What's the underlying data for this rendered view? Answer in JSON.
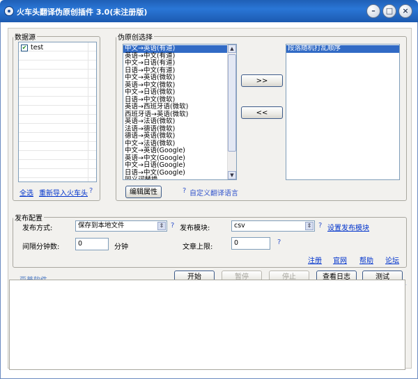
{
  "window": {
    "title": "火车头翻译伪原创插件 3.0(未注册版)",
    "min": "–",
    "max": "□",
    "close": "×"
  },
  "datasource": {
    "legend": "数据源",
    "items": [
      {
        "label": "test",
        "checked": true
      }
    ]
  },
  "pseudo": {
    "legend": "伪原创选择",
    "options": [
      "中文→英语(有道)",
      "英语→中文(有道)",
      "中文→日语(有道)",
      "日语→中文(有道)",
      "中文→英语(微软)",
      "英语→中文(微软)",
      "中文→日语(微软)",
      "日语→中文(微软)",
      "英语→西班牙语(微软)",
      "西班牙语→英语(微软)",
      "英语→法语(微软)",
      "法语→德语(微软)",
      "德语→英语(微软)",
      "中文→法语(微软)",
      "中文→英语(Google)",
      "英语→中文(Google)",
      "中文→日语(Google)",
      "日语→中文(Google)",
      "同义词替换"
    ],
    "selected": [
      "段落随机打乱顺序"
    ],
    "add_button": ">>",
    "remove_button": "<<",
    "edit_button": "编辑属性",
    "custom_help": "?",
    "custom_link": "自定义翻译语言"
  },
  "source_actions": {
    "select_all": "全选",
    "reimport": "重新导入火车头",
    "help": "?"
  },
  "publish": {
    "legend": "发布配置",
    "method_label": "发布方式:",
    "method_value": "保存到本地文件",
    "module_label": "发布模块:",
    "module_value": "csv",
    "module_help": "?",
    "method_help": "?",
    "module_link": "设置发布模块",
    "interval_label": "间隔分钟数:",
    "interval_value": "0",
    "interval_unit": "分钟",
    "limit_label": "文章上限:",
    "limit_value": "0",
    "limit_help": "?",
    "links": [
      "注册",
      "官网",
      "帮助",
      "论坛"
    ]
  },
  "footer": {
    "brand": "亚普软件",
    "start": "开始",
    "pause": "暂停",
    "stop": "停止",
    "view_log": "查看日志",
    "test": "测试"
  },
  "colors": {
    "title_bar": "#2a76d6",
    "selection": "#316ac5",
    "link": "#0033cc"
  }
}
